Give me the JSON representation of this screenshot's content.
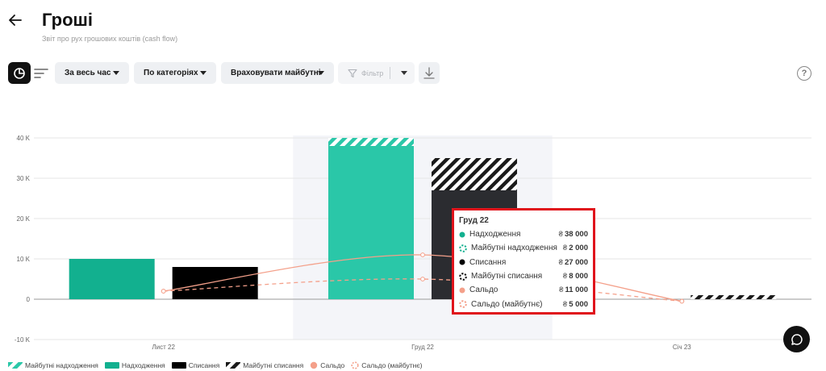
{
  "header": {
    "title": "Гроші",
    "subtitle": "Звіт про рух грошових коштів (cash flow)"
  },
  "toolbar": {
    "period_label": "За весь час",
    "category_label": "По категоріях",
    "future_label": "Враховувати майбутні",
    "filter_label": "Фільтр"
  },
  "help_label": "?",
  "colors": {
    "income": "#2ac7a8",
    "income_dark": "#12b08f",
    "expense": "#000000",
    "expense_dark": "#2b2c30",
    "balance": "#f4a08a",
    "highlight_band": "#f4f5f9",
    "tooltip_border": "#e0141c"
  },
  "chart_data": {
    "type": "bar",
    "categories": [
      "Лист 22",
      "Груд 22",
      "Січ 23"
    ],
    "yticks": [
      40000,
      30000,
      20000,
      10000,
      0,
      -10000
    ],
    "ytick_labels": [
      "40 K",
      "30 K",
      "20 K",
      "10 K",
      "0",
      "-10 K"
    ],
    "ylim": [
      -10000,
      40000
    ],
    "highlighted_category": "Груд 22",
    "series": [
      {
        "name": "Надходження",
        "kind": "bar",
        "values": [
          10000,
          38000,
          0
        ]
      },
      {
        "name": "Майбутні надходження",
        "kind": "bar",
        "values": [
          0,
          2000,
          0
        ]
      },
      {
        "name": "Списання",
        "kind": "bar",
        "values": [
          8000,
          27000,
          0
        ]
      },
      {
        "name": "Майбутні списання",
        "kind": "bar",
        "values": [
          0,
          8000,
          1000
        ]
      },
      {
        "name": "Сальдо",
        "kind": "line",
        "values": [
          2000,
          11000,
          -500
        ]
      },
      {
        "name": "Сальдо (майбутнє)",
        "kind": "line",
        "values": [
          2000,
          5000,
          -500
        ]
      }
    ]
  },
  "tooltip": {
    "title": "Груд 22",
    "rows": [
      {
        "label": "Надходження",
        "currency": "₴",
        "value": "38 000"
      },
      {
        "label": "Майбутні надходження",
        "currency": "₴",
        "value": "2 000"
      },
      {
        "label": "Списання",
        "currency": "₴",
        "value": "27 000"
      },
      {
        "label": "Майбутні списання",
        "currency": "₴",
        "value": "8 000"
      },
      {
        "label": "Сальдо",
        "currency": "₴",
        "value": "11 000"
      },
      {
        "label": "Сальдо (майбутнє)",
        "currency": "₴",
        "value": "5 000"
      }
    ]
  },
  "legend": [
    {
      "label": "Майбутні надходження",
      "swatch": "income-hatch"
    },
    {
      "label": "Надходження",
      "swatch": "income"
    },
    {
      "label": "Списання",
      "swatch": "expense"
    },
    {
      "label": "Майбутні списання",
      "swatch": "expense-hatch"
    },
    {
      "label": "Сальдо",
      "swatch": "balance-dot"
    },
    {
      "label": "Сальдо (майбутнє)",
      "swatch": "balance-future-dot"
    }
  ]
}
